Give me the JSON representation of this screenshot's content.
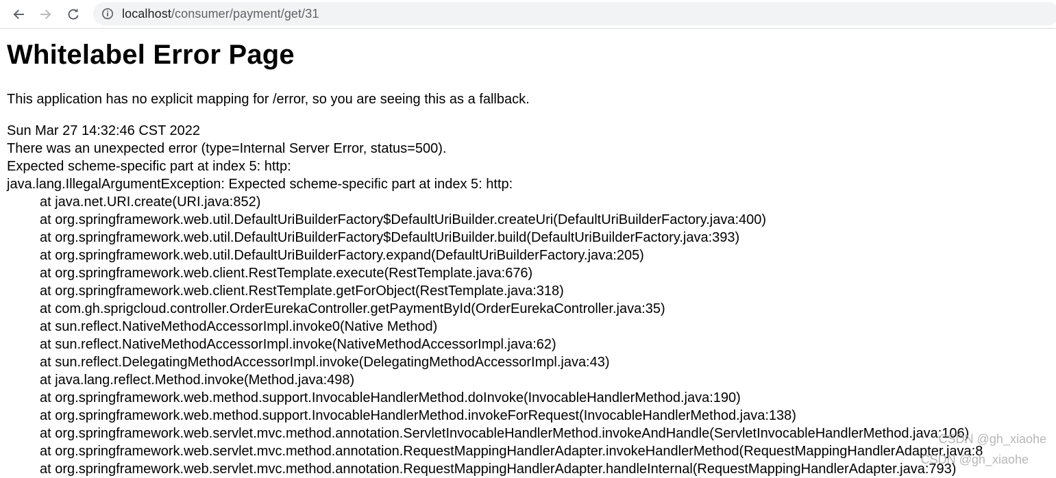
{
  "browser": {
    "url_host": "localhost",
    "url_path": "/consumer/payment/get/31",
    "icons": {
      "back": "arrow-left-icon",
      "forward": "arrow-right-icon",
      "reload": "reload-icon",
      "info": "info-icon"
    }
  },
  "page": {
    "title": "Whitelabel Error Page",
    "fallback_message": "This application has no explicit mapping for /error, so you are seeing this as a fallback.",
    "timestamp": "Sun Mar 27 14:32:46 CST 2022",
    "error_summary": "There was an unexpected error (type=Internal Server Error, status=500).",
    "message": "Expected scheme-specific part at index 5: http:",
    "exception": "java.lang.IllegalArgumentException: Expected scheme-specific part at index 5: http:",
    "stack_trace": [
      "at java.net.URI.create(URI.java:852)",
      "at org.springframework.web.util.DefaultUriBuilderFactory$DefaultUriBuilder.createUri(DefaultUriBuilderFactory.java:400)",
      "at org.springframework.web.util.DefaultUriBuilderFactory$DefaultUriBuilder.build(DefaultUriBuilderFactory.java:393)",
      "at org.springframework.web.util.DefaultUriBuilderFactory.expand(DefaultUriBuilderFactory.java:205)",
      "at org.springframework.web.client.RestTemplate.execute(RestTemplate.java:676)",
      "at org.springframework.web.client.RestTemplate.getForObject(RestTemplate.java:318)",
      "at com.gh.sprigcloud.controller.OrderEurekaController.getPaymentById(OrderEurekaController.java:35)",
      "at sun.reflect.NativeMethodAccessorImpl.invoke0(Native Method)",
      "at sun.reflect.NativeMethodAccessorImpl.invoke(NativeMethodAccessorImpl.java:62)",
      "at sun.reflect.DelegatingMethodAccessorImpl.invoke(DelegatingMethodAccessorImpl.java:43)",
      "at java.lang.reflect.Method.invoke(Method.java:498)",
      "at org.springframework.web.method.support.InvocableHandlerMethod.doInvoke(InvocableHandlerMethod.java:190)",
      "at org.springframework.web.method.support.InvocableHandlerMethod.invokeForRequest(InvocableHandlerMethod.java:138)",
      "at org.springframework.web.servlet.mvc.method.annotation.ServletInvocableHandlerMethod.invokeAndHandle(ServletInvocableHandlerMethod.java:106)",
      "at org.springframework.web.servlet.mvc.method.annotation.RequestMappingHandlerAdapter.invokeHandlerMethod(RequestMappingHandlerAdapter.java:8",
      "at org.springframework.web.servlet.mvc.method.annotation.RequestMappingHandlerAdapter.handleInternal(RequestMappingHandlerAdapter.java:793)"
    ]
  },
  "watermark": {
    "text": "CSDN @gh_xiaohe"
  }
}
